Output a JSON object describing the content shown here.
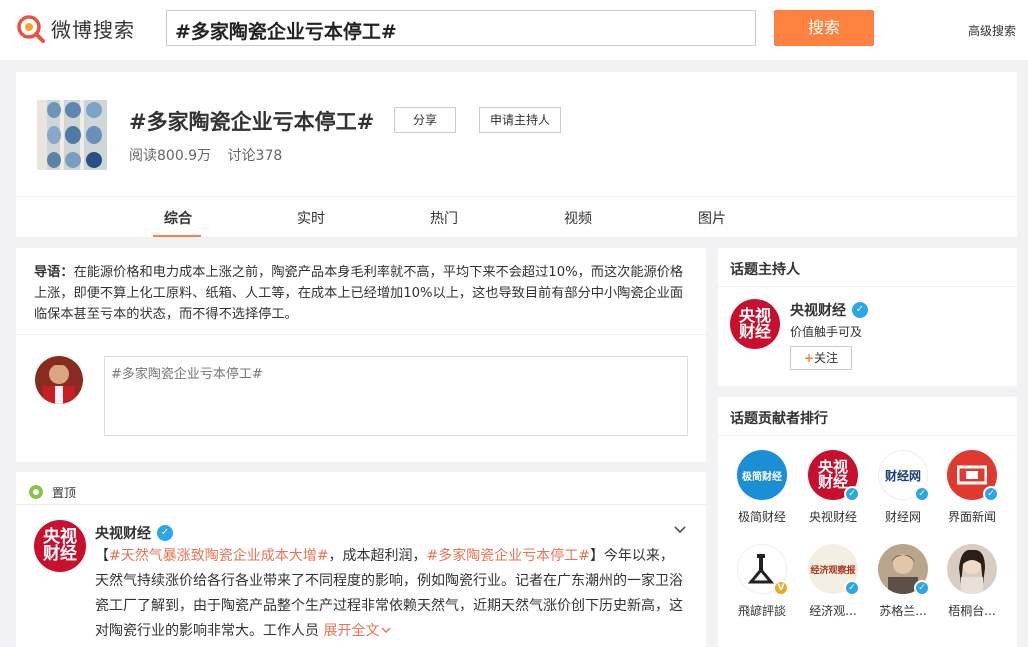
{
  "header": {
    "logo_text": "微博搜索",
    "search_value": "#多家陶瓷企业亏本停工#",
    "search_button": "搜索",
    "advanced_link": "高级搜索"
  },
  "topic": {
    "title": "#多家陶瓷企业亏本停工#",
    "share_label": "分享",
    "apply_host_label": "申请主持人",
    "reads": "阅读800.9万",
    "discussions": "讨论378",
    "tabs": [
      "综合",
      "实时",
      "热门",
      "视频",
      "图片"
    ]
  },
  "intro": {
    "label": "导语：",
    "text": "在能源价格和电力成本上涨之前，陶瓷产品本身毛利率就不高，平均下来不会超过10%，而这次能源价格上涨，即便不算上化工原料、纸箱、人工等，在成本上已经增加10%以上，这也导致目前有部分中小陶瓷企业面临保本甚至亏本的状态，而不得不选择停工。"
  },
  "compose": {
    "placeholder": "#多家陶瓷企业亏本停工#"
  },
  "feed": {
    "pin_label": "置顶",
    "post": {
      "author": "央视财经",
      "tag1": "#天然气暴涨致陶瓷企业成本大增#",
      "mid1": "，成本超利润，",
      "tag2": "#多家陶瓷企业亏本停工#",
      "body": "】今年以来，天然气持续涨价给各行各业带来了不同程度的影响，例如陶瓷行业。记者在广东潮州的一家卫浴瓷工厂了解到，由于陶瓷产品整个生产过程非常依赖天然气，近期天然气涨价创下历史新高，这对陶瓷行业的影响非常大。工作人员",
      "open_bracket": "【",
      "expand": "展开全文"
    }
  },
  "host_card": {
    "title": "话题主持人",
    "name": "央视财经",
    "desc": "价值触手可及",
    "follow": "关注",
    "follow_plus": "+"
  },
  "rank_card": {
    "title": "话题贡献者排行",
    "items": [
      {
        "name": "极简财经"
      },
      {
        "name": "央视财经"
      },
      {
        "name": "财经网"
      },
      {
        "name": "界面新闻"
      },
      {
        "name": "飛諺評談"
      },
      {
        "name": "经济观..."
      },
      {
        "name": "苏格兰..."
      },
      {
        "name": "梧桐台..."
      }
    ]
  },
  "colors": {
    "accent": "#ff8140",
    "link": "#eb7350",
    "verified": "#2aa7eb",
    "cctv_red": "#c8102e"
  },
  "avatar_texts": {
    "cctv_line1": "央视",
    "cctv_line2": "财经",
    "jijian": "极简财经",
    "caijing_wang": "财经网",
    "jingji_guancha": "经济观察报"
  }
}
